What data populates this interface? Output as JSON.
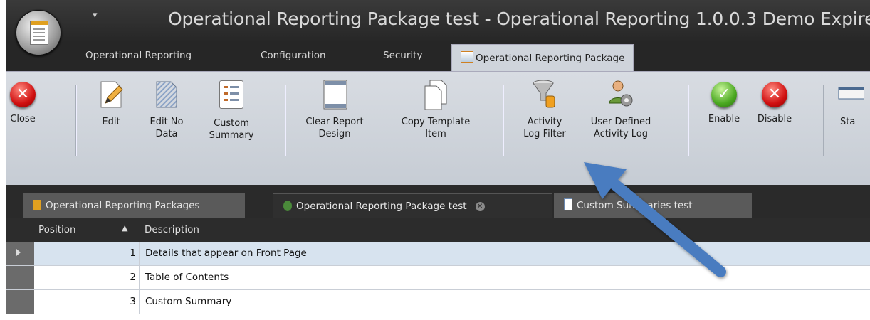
{
  "window": {
    "title": "Operational Reporting Package test - Operational Reporting 1.0.0.3 Demo Expire",
    "qat_symbol": "▾"
  },
  "ribbon_tabs": [
    {
      "label": "Operational Reporting"
    },
    {
      "label": "Configuration"
    },
    {
      "label": "Security"
    },
    {
      "label": "Operational Reporting Package"
    }
  ],
  "ribbon_buttons": {
    "close": "Close",
    "edit": "Edit",
    "edit_no_data": "Edit No\nData",
    "custom_summary": "Custom\nSummary",
    "clear_report_design": "Clear Report\nDesign",
    "copy_template_item": "Copy Template\nItem",
    "activity_log_filter": "Activity\nLog Filter",
    "user_defined_activity_log": "User Defined\nActivity Log",
    "enable": "Enable",
    "disable": "Disable",
    "partial": "Sta"
  },
  "doc_tabs": [
    {
      "label": "Operational Reporting Packages"
    },
    {
      "label": "Operational Reporting Package test"
    },
    {
      "label": "Custom Summaries test"
    }
  ],
  "grid": {
    "columns": {
      "position": "Position",
      "description": "Description",
      "sort_glyph": "▲"
    },
    "rows": [
      {
        "position": "1",
        "description": "Details that appear on Front Page"
      },
      {
        "position": "2",
        "description": "Table of Contents"
      },
      {
        "position": "3",
        "description": "Custom Summary"
      }
    ]
  },
  "colors": {
    "ribbon_bg": "#cfd4db",
    "dark_chrome": "#2b2b2b",
    "selected_row": "#d7e3ef",
    "annotation_arrow": "#4a7cc0"
  }
}
